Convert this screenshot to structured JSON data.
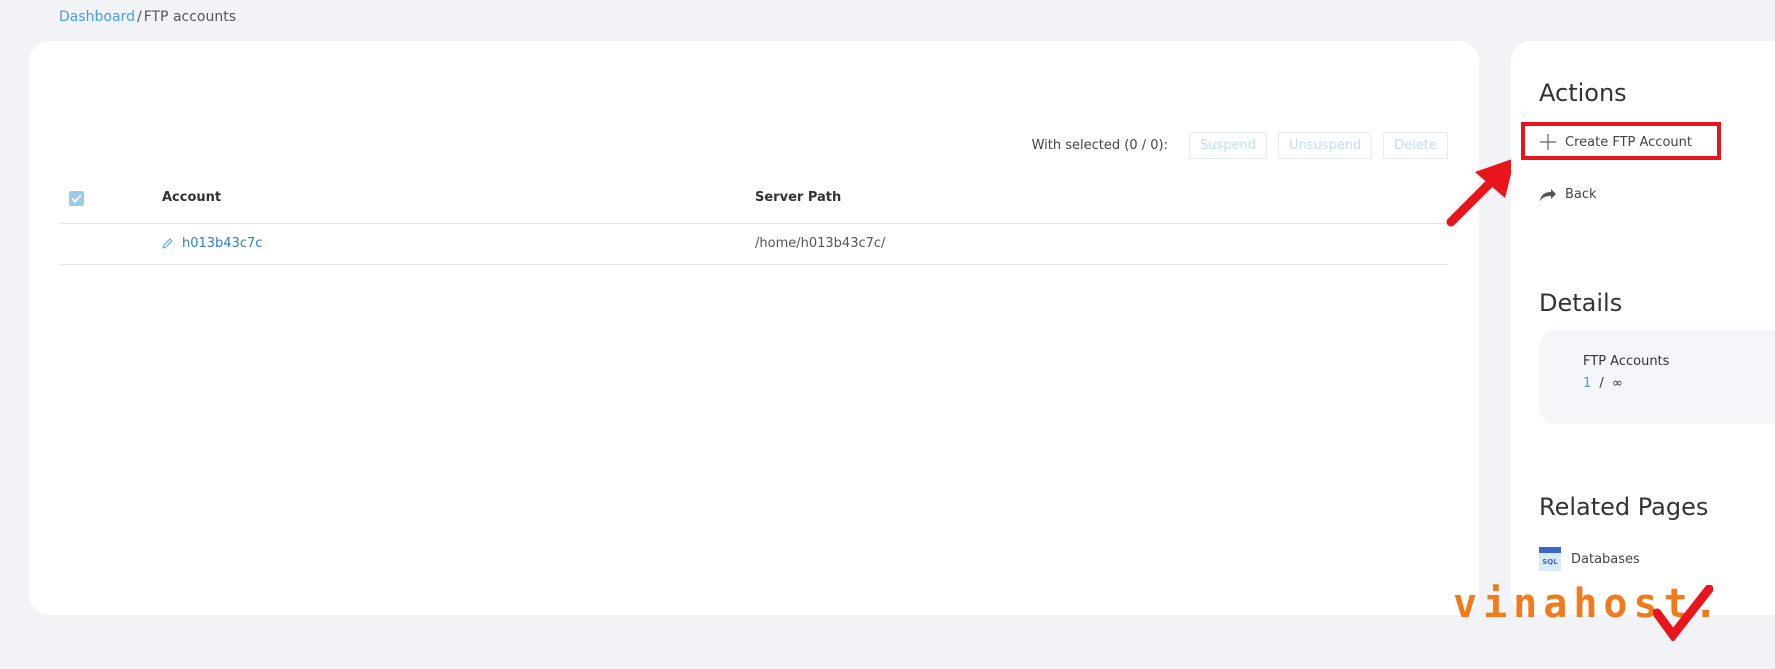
{
  "breadcrumb": {
    "root": "Dashboard",
    "separator": "/",
    "current": "FTP accounts"
  },
  "toolbar": {
    "with_selected": "With selected (0 / 0):",
    "suspend": "Suspend",
    "unsuspend": "Unsuspend",
    "delete": "Delete"
  },
  "table": {
    "headers": {
      "account": "Account",
      "server_path": "Server Path"
    },
    "rows": [
      {
        "account": "h013b43c7c",
        "server_path": "/home/h013b43c7c/"
      }
    ]
  },
  "sidebar": {
    "actions_title": "Actions",
    "create_label": "Create FTP Account",
    "back_label": "Back",
    "details_title": "Details",
    "details_label": "FTP Accounts",
    "details_used": "1",
    "details_sep": "/",
    "details_limit": "∞",
    "related_title": "Related Pages",
    "related_item": "Databases"
  },
  "watermark": {
    "text": "vinahost."
  },
  "colors": {
    "accent": "#4a9fd8",
    "highlight": "#e8151b",
    "watermark": "#f27a1a"
  },
  "icons": [
    "check-icon",
    "pencil-icon",
    "plus-icon",
    "share-arrow-icon",
    "sql-database-icon",
    "red-pointer-arrow"
  ]
}
